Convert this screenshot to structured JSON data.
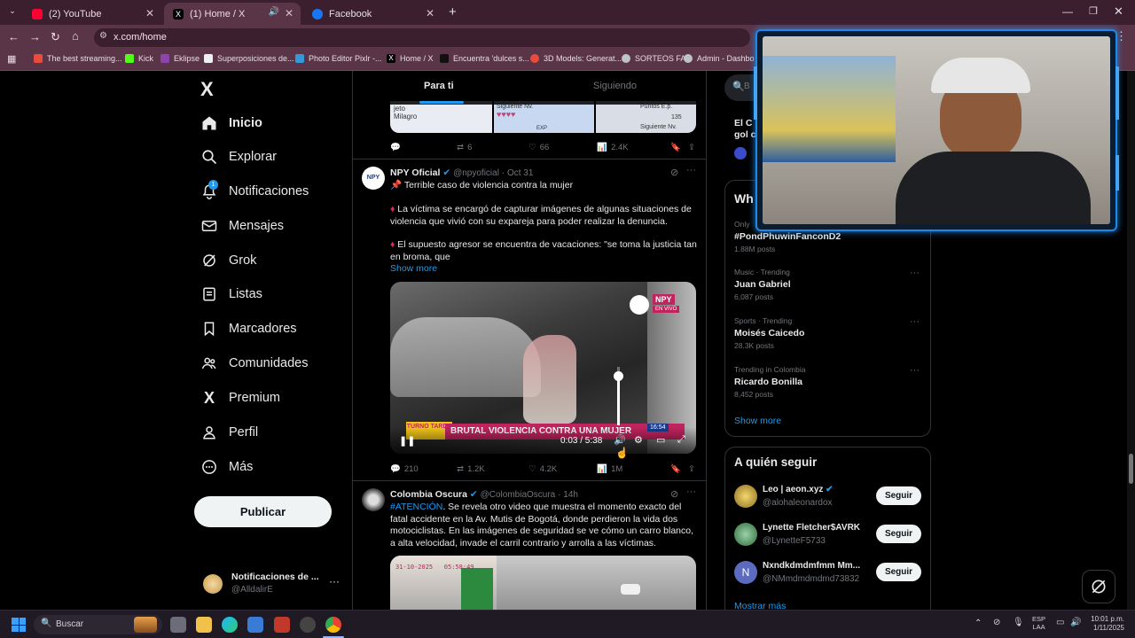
{
  "browser": {
    "tabs": [
      {
        "label": "(2) YouTube",
        "color": "#ff0033"
      },
      {
        "label": "(1) Home / X",
        "color": "#000000"
      },
      {
        "label": "Facebook",
        "color": "#1877f2"
      }
    ],
    "new_tab": "+",
    "url": "x.com/home",
    "bookmarks": [
      {
        "label": "The best streaming...",
        "color": "#e74c3c"
      },
      {
        "label": "Kick",
        "color": "#53fc18"
      },
      {
        "label": "Eklipse",
        "color": "#8e44ad"
      },
      {
        "label": "Superposiciones de...",
        "color": "#ecf0f1"
      },
      {
        "label": "Photo Editor Pixlr -...",
        "color": "#3498db"
      },
      {
        "label": "Home / X",
        "color": "#000000"
      },
      {
        "label": "Encuentra 'dulces s...",
        "color": "#111111"
      },
      {
        "label": "3D Models: Generat...",
        "color": "#e74c3c"
      },
      {
        "label": "SORTEOS FA",
        "color": "#bdc3c7"
      },
      {
        "label": "Admin - Dashbo",
        "color": "#bdc3c7"
      }
    ]
  },
  "nav": {
    "logo": "X",
    "items": [
      {
        "label": "Inicio",
        "icon": "home-icon"
      },
      {
        "label": "Explorar",
        "icon": "search-icon"
      },
      {
        "label": "Notificaciones",
        "icon": "bell-icon"
      },
      {
        "label": "Mensajes",
        "icon": "mail-icon"
      },
      {
        "label": "Grok",
        "icon": "grok-icon"
      },
      {
        "label": "Listas",
        "icon": "list-icon"
      },
      {
        "label": "Marcadores",
        "icon": "bookmark-icon"
      },
      {
        "label": "Comunidades",
        "icon": "people-icon"
      },
      {
        "label": "Premium",
        "icon": "x-icon"
      },
      {
        "label": "Perfil",
        "icon": "person-icon"
      },
      {
        "label": "Más",
        "icon": "more-icon"
      }
    ],
    "notif_badge": "1",
    "post_button": "Publicar",
    "account": {
      "name": "Notificaciones de ...",
      "handle": "@AlldalirE"
    }
  },
  "feed": {
    "tabs": [
      "Para ti",
      "Siguiendo"
    ],
    "prev_tweet_stats": {
      "replies": "",
      "reposts": "6",
      "likes": "66",
      "views": "2.4K"
    },
    "prev_media_text": {
      "left": "jeto\nMilagro",
      "mid": "Siguiente Nv.",
      "right": "Puntos E.p.",
      "num": "135",
      "mid2": "EXP",
      "right2": "Siguiente Nv."
    },
    "tweet1": {
      "name": "NPY Oficial",
      "handle": "@npyoficial",
      "date": "· Oct 31",
      "line1": "Terrible caso de violencia contra la mujer",
      "line2": "La víctima se encargó de capturar imágenes de algunas situaciones de violencia que vivió con su expareja para poder realizar la denuncia.",
      "line3": "El supuesto agresor se encuentra de vacaciones: \"se toma la justicia tan en broma, que",
      "show_more": "Show more",
      "video": {
        "time": "0:03 / 5:38",
        "ticker": "BRUTAL VIOLENCIA CONTRA UNA MUJER",
        "show": "TURNO TARDE",
        "badge": "EN VIVO",
        "brand": "NPY",
        "clock": "16:54",
        "volume": 0.85
      },
      "stats": {
        "replies": "210",
        "reposts": "1.2K",
        "likes": "4.2K",
        "views": "1M"
      }
    },
    "tweet2": {
      "name": "Colombia Oscura",
      "handle": "@ColombiaOscura",
      "date": "· 14h",
      "hashtag": "#ATENCIÓN",
      "text": ". Se revela otro video que muestra el momento exacto del fatal accidente en la Av. Mutis de Bogotá, donde perdieron la vida dos motociclistas. En las imágenes de seguridad se ve cómo un carro blanco, a alta velocidad, invade el carril contrario y arrolla a las víctimas.",
      "video_stamp": "31-10-2025   05:58:49"
    }
  },
  "right": {
    "search_placeholder": "B",
    "partial_card_title": "El C",
    "partial_card_line": "gol c",
    "trends_title_partial": "Wh",
    "trends": [
      {
        "cat": "Only",
        "name": "#PondPhuwinFanconD2",
        "posts": "1.88M posts"
      },
      {
        "cat": "Music · Trending",
        "name": "Juan Gabriel",
        "posts": "6,087 posts"
      },
      {
        "cat": "Sports · Trending",
        "name": "Moisés Caicedo",
        "posts": "28.3K posts"
      },
      {
        "cat": "Trending in Colombia",
        "name": "Ricardo Bonilla",
        "posts": "8,452 posts"
      }
    ],
    "show_more": "Show more",
    "who_to_follow": {
      "title": "A quién seguir",
      "users": [
        {
          "name": "Leo | aeon.xyz",
          "handle": "@alohaleonardox",
          "button": "Seguir"
        },
        {
          "name": "Lynette Fletcher$AVRK",
          "handle": "@LynetteF5733",
          "button": "Seguir"
        },
        {
          "name": "Nxndkdmdmfmm Mm...",
          "handle": "@NMmdmdmdmd73832",
          "button": "Seguir"
        }
      ],
      "more": "Mostrar más"
    }
  },
  "taskbar": {
    "search": "Buscar",
    "lang": "ESP\nLAA",
    "time": "10:01 p.m.",
    "date": "1/11/2025"
  }
}
